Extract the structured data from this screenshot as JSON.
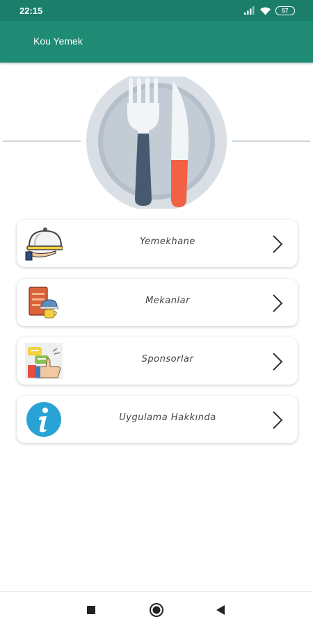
{
  "status": {
    "time": "22:15",
    "battery": "57"
  },
  "app": {
    "title": "Kou Yemek"
  },
  "menu": [
    {
      "label": "Yemekhane",
      "icon": "serving-cloche-icon"
    },
    {
      "label": "Mekanlar",
      "icon": "restaurant-menu-icon"
    },
    {
      "label": "Sponsorlar",
      "icon": "sponsor-thumbs-up-icon"
    },
    {
      "label": "Uygulama Hakkında",
      "icon": "info-icon"
    }
  ],
  "navigation": {
    "buttons": [
      "recent-apps-button",
      "home-button",
      "back-button"
    ]
  },
  "colors": {
    "statusbar": "#1b7e6b",
    "appbar": "#1f8b74",
    "card": "#ffffff",
    "info_blue": "#29a3d6"
  }
}
